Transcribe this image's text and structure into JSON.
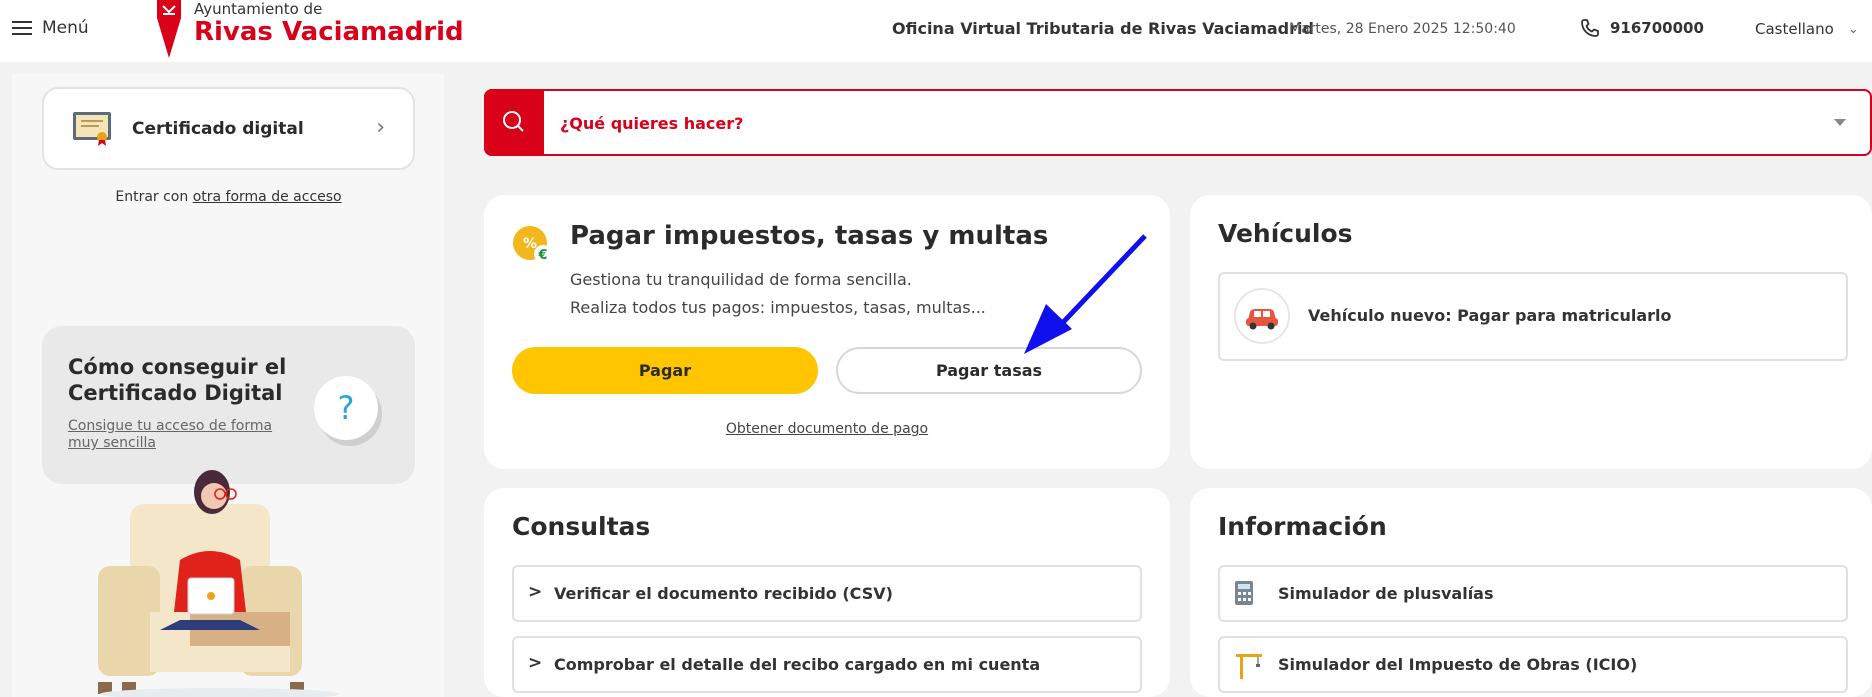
{
  "header": {
    "menu_label": "Menú",
    "org_line1": "Ayuntamiento de",
    "org_line2": "Rivas Vaciamadrid",
    "office_title": "Oficina Virtual Tributaria de Rivas Vaciamadrid",
    "datetime": "Martes, 28 Enero 2025 12:50:40",
    "phone": "916700000",
    "language": "Castellano"
  },
  "sidebar": {
    "cert_label": "Certificado digital",
    "alt_prefix": "Entrar con ",
    "alt_link": "otra forma de acceso",
    "howto_title": "Cómo conseguir el Certificado Digital",
    "howto_link": "Consigue tu acceso de forma muy sencilla",
    "howto_icon": "?"
  },
  "search": {
    "placeholder": "¿Qué quieres hacer?"
  },
  "pay_card": {
    "title": "Pagar impuestos, tasas y multas",
    "desc_line1": "Gestiona tu tranquilidad de forma sencilla.",
    "desc_line2": "Realiza todos tus pagos: impuestos, tasas, multas...",
    "btn_pay": "Pagar",
    "btn_fees": "Pagar tasas",
    "doc_link": "Obtener documento de pago"
  },
  "vehicles": {
    "title": "Vehículos",
    "item": "Vehículo nuevo: Pagar para matricularlo"
  },
  "queries": {
    "title": "Consultas",
    "items": [
      "Verificar el documento recibido (CSV)",
      "Comprobar el detalle del recibo cargado en mi cuenta"
    ]
  },
  "info": {
    "title": "Información",
    "items": [
      "Simulador de plusvalías",
      "Simulador del Impuesto de Obras (ICIO)"
    ]
  },
  "colors": {
    "brand_red": "#d90019",
    "accent_yellow": "#ffc600",
    "annotation_arrow": "#1010ee"
  }
}
